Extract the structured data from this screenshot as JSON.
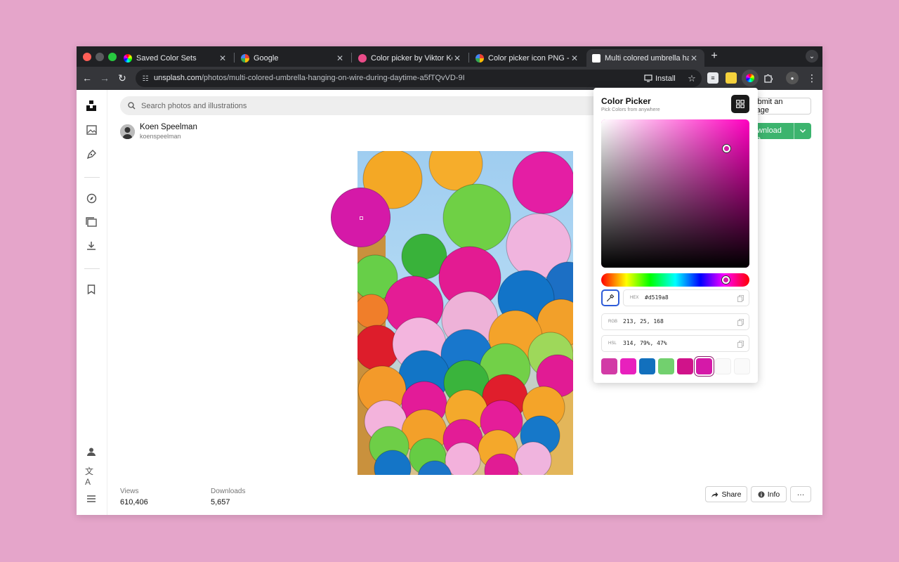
{
  "browser": {
    "tabs": [
      {
        "title": "Saved Color Sets",
        "favicon_color": "#ea4335"
      },
      {
        "title": "Google",
        "favicon_color": "#4285f4"
      },
      {
        "title": "Color picker by Viktor Ketov on Dribbble",
        "favicon_color": "#ea4c89"
      },
      {
        "title": "Color picker icon PNG - Google Search",
        "favicon_color": "#4285f4"
      },
      {
        "title": "Multi colored umbrella hanging on wire",
        "favicon_color": "#ffffff"
      }
    ],
    "new_tab": "+",
    "url_host": "unsplash.com",
    "url_path": "/photos/multi-colored-umbrella-hanging-on-wire-during-daytime-a5fTQvVD-9I",
    "install_label": "Install"
  },
  "page": {
    "search_placeholder": "Search photos and illustrations",
    "submit_label": "Submit an image",
    "download_label": "Download free",
    "author": {
      "name": "Koen Speelman",
      "handle": "koenspeelman"
    },
    "stats": [
      {
        "label": "Views",
        "value": "610,406"
      },
      {
        "label": "Downloads",
        "value": "5,657"
      }
    ],
    "share_label": "Share",
    "info_label": "Info",
    "more_label": "···"
  },
  "picker": {
    "title": "Color Picker",
    "subtitle": "Pick Colors from anywhere",
    "hex_label": "HEX",
    "hex_value": "#d519a8",
    "rgb_label": "RGB",
    "rgb_value": "213, 25, 168",
    "hsl_label": "HSL",
    "hsl_value": "314, 79%, 47%",
    "swatches": [
      "#d23ba6",
      "#e820bd",
      "#1270bd",
      "#72d06e",
      "#d0138a",
      "#d519a8"
    ]
  }
}
